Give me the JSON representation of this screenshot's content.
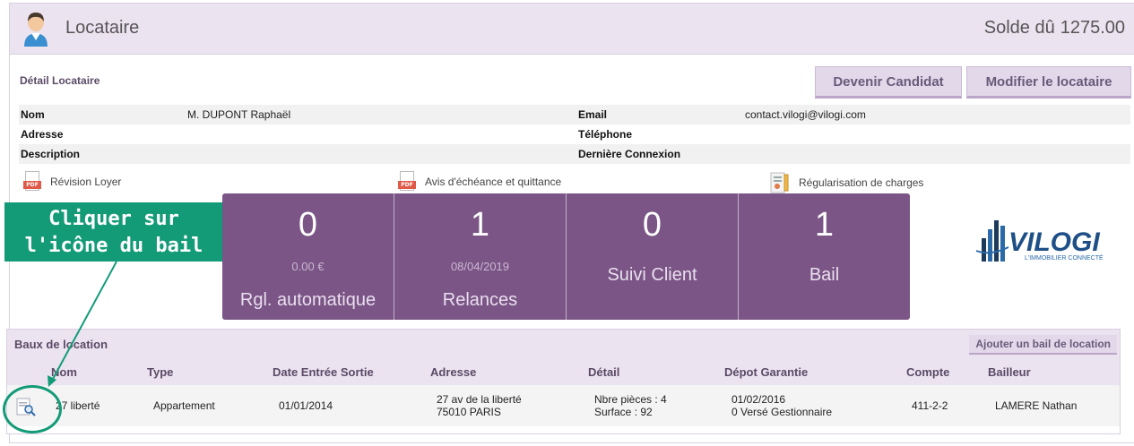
{
  "header": {
    "title": "Locataire",
    "balance_label": "Solde dû",
    "balance_value": "1275.00"
  },
  "detail": {
    "section_title": "Détail Locataire",
    "buttons": {
      "candidat": "Devenir Candidat",
      "modifier": "Modifier le locataire"
    },
    "fields": {
      "nom_label": "Nom",
      "nom_value": "M. DUPONT Raphaël",
      "email_label": "Email",
      "email_value": "contact.vilogi@vilogi.com",
      "adresse_label": "Adresse",
      "telephone_label": "Téléphone",
      "description_label": "Description",
      "connexion_label": "Dernière Connexion"
    }
  },
  "documents": [
    {
      "label": "Révision Loyer",
      "icon": "pdf-icon"
    },
    {
      "label": "Avis d'échéance et quittance",
      "icon": "pdf-icon"
    },
    {
      "label": "Régularisation de charges",
      "icon": "charges-document-icon"
    }
  ],
  "annotation": {
    "line1": "Cliquer sur",
    "line2": "l'icône du bail",
    "color": "#139b78"
  },
  "tiles": [
    {
      "number": "0",
      "sub": "0.00 €",
      "label": "Rgl. automatique"
    },
    {
      "number": "1",
      "sub": "08/04/2019",
      "label": "Relances"
    },
    {
      "number": "0",
      "sub": "",
      "label": "Suivi Client"
    },
    {
      "number": "1",
      "sub": "",
      "label": "Bail"
    }
  ],
  "logo": {
    "name": "VILOGI",
    "tagline": "L'IMMOBILIER CONNECTÉ"
  },
  "leases": {
    "title": "Baux de location",
    "add_button": "Ajouter un bail de location",
    "columns": [
      "Nom",
      "Type",
      "Date Entrée Sortie",
      "Adresse",
      "Détail",
      "Dépot Garantie",
      "Compte",
      "Bailleur"
    ],
    "rows": [
      {
        "nom": "27 liberté",
        "type": "Appartement",
        "date": "01/01/2014",
        "adresse_1": "27 av de la liberté",
        "adresse_2": "75010 PARIS",
        "detail_1": "Nbre pièces : 4",
        "detail_2": "Surface : 92",
        "depot_1": "01/02/2016",
        "depot_2": "0 Versé Gestionnaire",
        "compte": "411-2-2",
        "bailleur": "LAMERE Nathan"
      }
    ]
  },
  "colors": {
    "accent": "#7a5585",
    "header_bg": "#ece3f0",
    "button_bg": "#e3d7ea",
    "annotation": "#139b78"
  }
}
